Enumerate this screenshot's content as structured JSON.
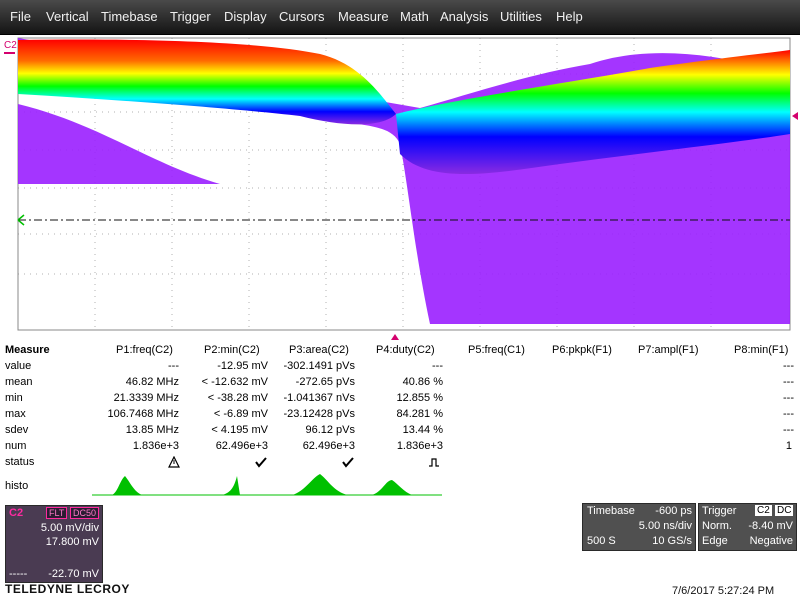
{
  "menu": {
    "items": [
      "File",
      "Vertical",
      "Timebase",
      "Trigger",
      "Display",
      "Cursors",
      "Measure",
      "Math",
      "Analysis",
      "Utilities",
      "Help"
    ]
  },
  "trace": {
    "channel_label": "C2",
    "color": "#d4006e"
  },
  "measure": {
    "title": "Measure",
    "columns": [
      "P1:freq(C2)",
      "P2:min(C2)",
      "P3:area(C2)",
      "P4:duty(C2)",
      "P5:freq(C1)",
      "P6:pkpk(F1)",
      "P7:ampl(F1)",
      "P8:min(F1)"
    ],
    "rows": [
      {
        "label": "value",
        "cells": [
          "---",
          "-12.95 mV",
          "-302.1491 pVs",
          "---",
          "",
          "",
          "",
          "---"
        ]
      },
      {
        "label": "mean",
        "cells": [
          "46.82 MHz",
          "< -12.632 mV",
          "-272.65 pVs",
          "40.86 %",
          "",
          "",
          "",
          "---"
        ]
      },
      {
        "label": "min",
        "cells": [
          "21.3339 MHz",
          "< -38.28 mV",
          "-1.041367 nVs",
          "12.855 %",
          "",
          "",
          "",
          "---"
        ]
      },
      {
        "label": "max",
        "cells": [
          "106.7468 MHz",
          "< -6.89 mV",
          "-23.12428 pVs",
          "84.281 %",
          "",
          "",
          "",
          "---"
        ]
      },
      {
        "label": "sdev",
        "cells": [
          "13.85 MHz",
          "< 4.195 mV",
          "96.12 pVs",
          "13.44 %",
          "",
          "",
          "",
          "---"
        ]
      },
      {
        "label": "num",
        "cells": [
          "1.836e+3",
          "62.496e+3",
          "62.496e+3",
          "1.836e+3",
          "",
          "",
          "",
          "1"
        ]
      },
      {
        "label": "status",
        "cells": [
          "",
          "",
          "",
          "",
          "",
          "",
          "",
          ""
        ]
      }
    ],
    "status_icons": [
      "warning-icon",
      "checkmark-icon",
      "checkmark-icon",
      "pulse-icon"
    ],
    "histo_label": "histo"
  },
  "channel_box": {
    "name": "C2",
    "badge1": "FLT",
    "badge2": "DC50",
    "vdiv": "5.00 mV/div",
    "offset": "17.800 mV",
    "bottom_left": "-----",
    "bottom_value": "-22.70 mV"
  },
  "timebase": {
    "title": "Timebase",
    "delay": "-600 ps",
    "tdiv": "5.00 ns/div",
    "samples": "500 S",
    "rate": "10 GS/s"
  },
  "trigger": {
    "title": "Trigger",
    "chan": "C2",
    "coupling": "DC",
    "mode": "Norm.",
    "level": "-8.40 mV",
    "type": "Edge",
    "slope": "Negative"
  },
  "brand": "TELEDYNE LECROY",
  "datetime": "7/6/2017  5:27:24 PM"
}
